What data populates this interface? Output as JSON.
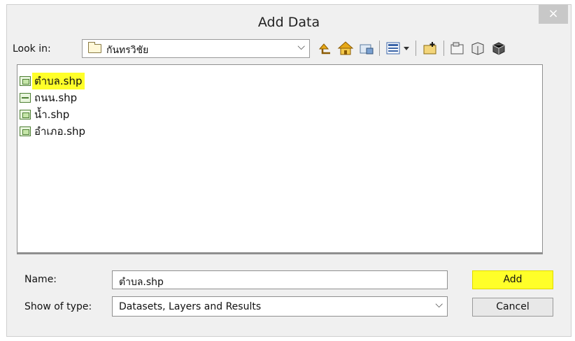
{
  "window": {
    "title": "Add Data",
    "close_glyph": "×"
  },
  "look_in": {
    "label": "Look in:",
    "value": "กันทรวิชัย",
    "arrow": "⌵"
  },
  "toolbar": [
    "up-one-level-icon",
    "home-icon",
    "connect-folder-icon",
    "list-view-icon",
    "view-dropdown-icon",
    "new-folder-icon",
    "new-file-icon",
    "new-table-icon",
    "toolbox-icon"
  ],
  "files": [
    {
      "name": "ตำบล.shp",
      "icon": "polygon-feature-icon",
      "highlighted": true
    },
    {
      "name": "ถนน.shp",
      "icon": "line-feature-icon",
      "highlighted": false
    },
    {
      "name": "น้ำ.shp",
      "icon": "polygon-feature-icon",
      "highlighted": false
    },
    {
      "name": "อำเภอ.shp",
      "icon": "polygon-feature-icon",
      "highlighted": false
    }
  ],
  "name_field": {
    "label": "Name:",
    "value": "ตำบล.shp"
  },
  "type_field": {
    "label": "Show of type:",
    "value": "Datasets, Layers and Results",
    "arrow": "⌵"
  },
  "buttons": {
    "add": "Add",
    "cancel": "Cancel"
  },
  "colors": {
    "highlight": "#ffff29",
    "window_bg": "#f0f0f0"
  }
}
